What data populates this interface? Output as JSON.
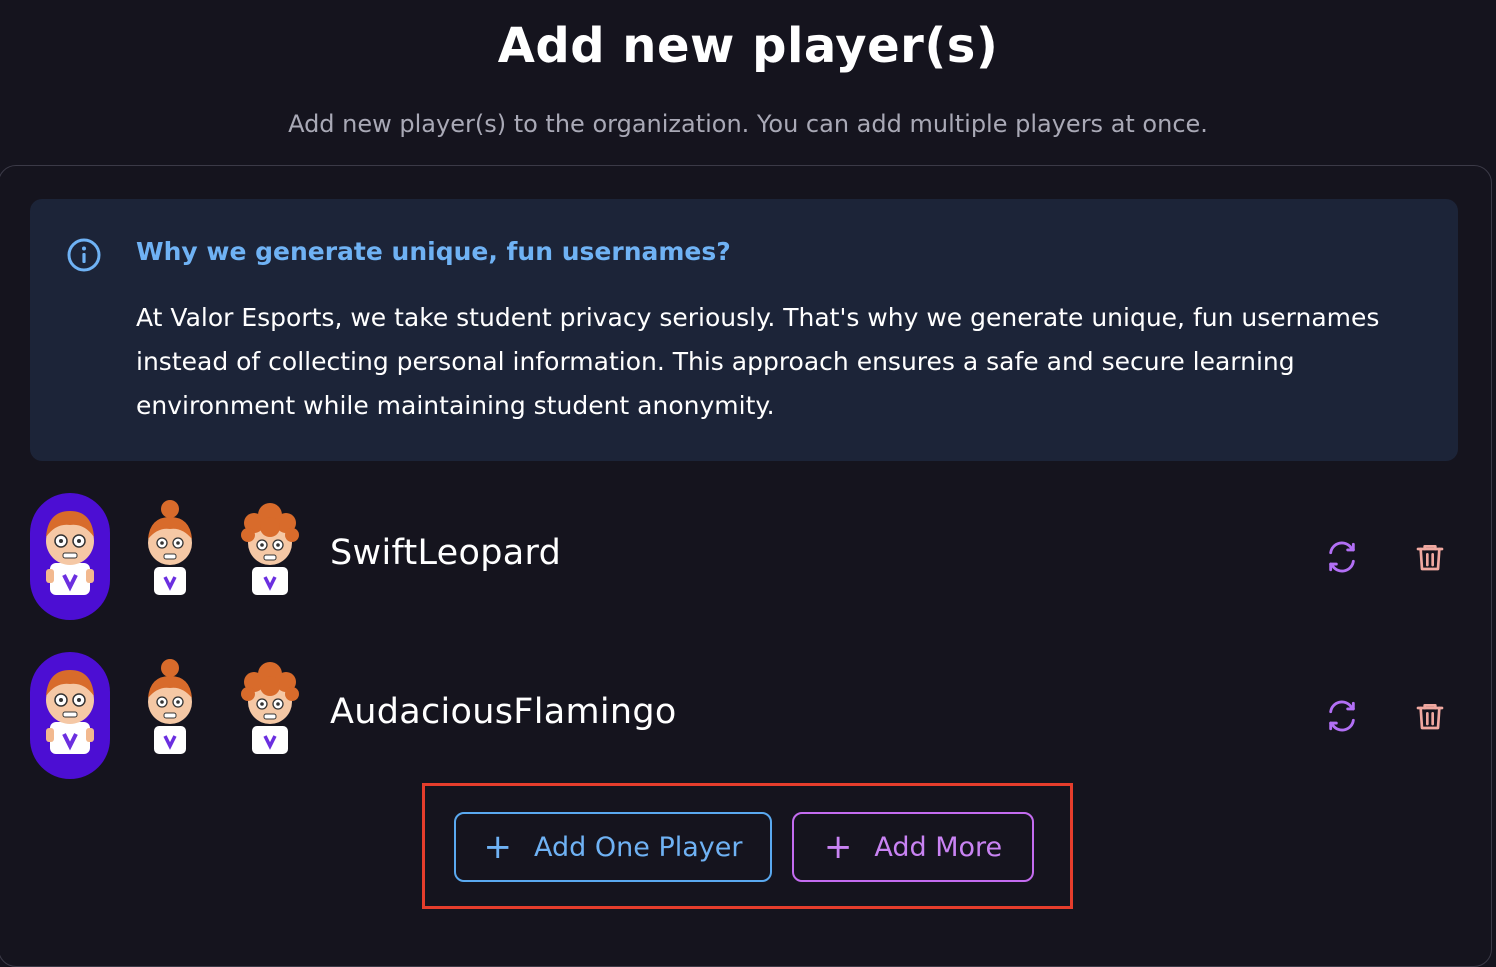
{
  "header": {
    "title": "Add new player(s)",
    "subtitle": "Add new player(s) to the organization. You can add multiple players at once."
  },
  "info": {
    "icon": "info-icon",
    "title": "Why we generate unique, fun usernames?",
    "body": "At Valor Esports, we take student privacy seriously. That's why we generate unique, fun usernames instead of collecting personal information. This approach ensures a safe and secure learning environment while maintaining student anonymity."
  },
  "players": [
    {
      "username": "SwiftLeopard",
      "avatars": [
        "avatar-short-hair",
        "avatar-bun-hair",
        "avatar-curly-hair"
      ],
      "selected_avatar": 0
    },
    {
      "username": "AudaciousFlamingo",
      "avatars": [
        "avatar-short-hair",
        "avatar-bun-hair",
        "avatar-curly-hair"
      ],
      "selected_avatar": 0
    }
  ],
  "row_actions": {
    "regenerate_icon": "refresh-icon",
    "delete_icon": "trash-icon"
  },
  "buttons": {
    "add_one_label": "Add One Player",
    "add_more_label": "Add More"
  },
  "colors": {
    "background": "#15141e",
    "info_background": "#1c2438",
    "info_accent": "#6fb2f4",
    "selected_avatar": "#4c0ed3",
    "regenerate": "#b26ff5",
    "delete": "#f0a8a0",
    "add_one": "#5aa9f0",
    "add_more": "#c46cf0",
    "highlight": "#e53d2c"
  }
}
